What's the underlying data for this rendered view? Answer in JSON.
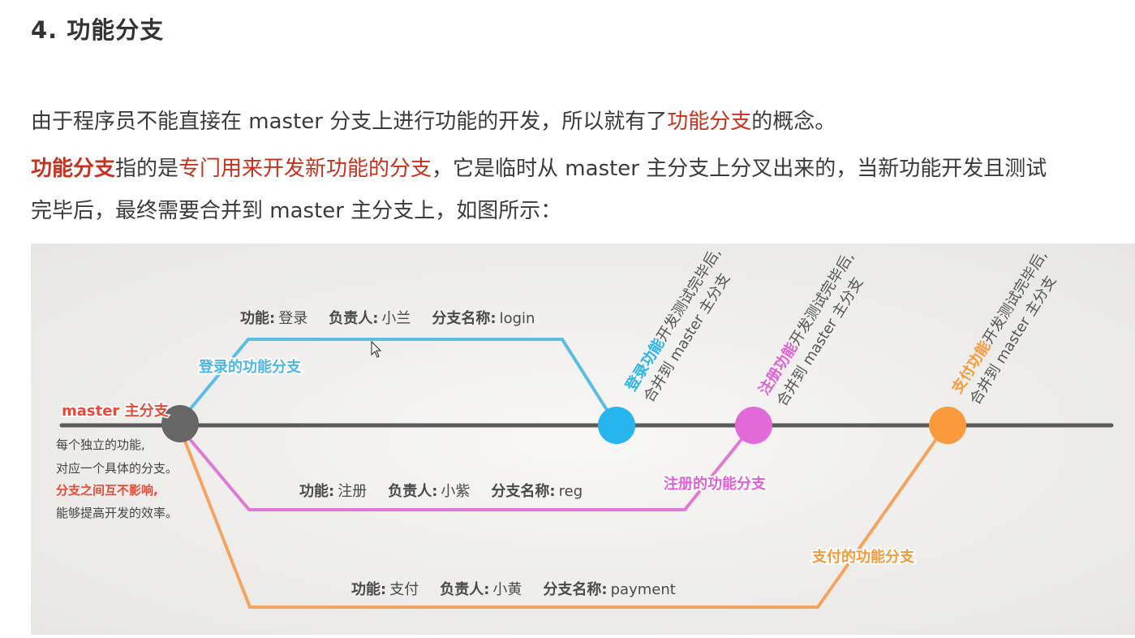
{
  "heading": "4. 功能分支",
  "para1": {
    "before": "由于程序员不能直接在 master 分支上进行功能的开发，所以就有了",
    "highlight": "功能分支",
    "after": "的概念。"
  },
  "para2": {
    "term": "功能分支",
    "mid": "指的是",
    "highlight": "专门用来开发新功能的分支",
    "rest_line1": "，它是临时从 master 主分支上分叉出来的，当新功能开发且测试",
    "line2": "完毕后，最终需要合并到 master 主分支上，如图所示："
  },
  "diagram": {
    "master_label": "master 主分支",
    "notes": [
      "每个独立的功能,",
      "对应一个具体的分支。",
      "分支之间互不影响,",
      "能够提高开发的效率。"
    ],
    "colors": {
      "master_line": "#5a5a5a",
      "master_node": "#666666",
      "login": "#5bbce4",
      "login_node": "#27b5ee",
      "reg": "#e07ad7",
      "reg_node": "#e26ad8",
      "payment": "#f4a460",
      "payment_node": "#fb9a3c",
      "red": "#e84a3a",
      "bg": "#ecebe8"
    },
    "branches": [
      {
        "id": "login",
        "branch_label": "登录的功能分支",
        "info": {
          "k1": "功能:",
          "v1": "登录",
          "k2": "负责人:",
          "v2": "小兰",
          "k3": "分支名称:",
          "v3": "login"
        },
        "merge": {
          "bold": "登录功能",
          "rest": "开发测试完毕后,",
          "line2": "合并到 master 主分支"
        }
      },
      {
        "id": "reg",
        "branch_label": "注册的功能分支",
        "info": {
          "k1": "功能:",
          "v1": "注册",
          "k2": "负责人:",
          "v2": "小紫",
          "k3": "分支名称:",
          "v3": "reg"
        },
        "merge": {
          "bold": "注册功能",
          "rest": "开发测试完毕后,",
          "line2": "合并到 master 主分支"
        }
      },
      {
        "id": "payment",
        "branch_label": "支付的功能分支",
        "info": {
          "k1": "功能:",
          "v1": "支付",
          "k2": "负责人:",
          "v2": "小黄",
          "k3": "分支名称:",
          "v3": "payment"
        },
        "merge": {
          "bold": "支付功能",
          "rest": "开发测试完毕后,",
          "line2": "合并到 master 主分支"
        }
      }
    ]
  }
}
